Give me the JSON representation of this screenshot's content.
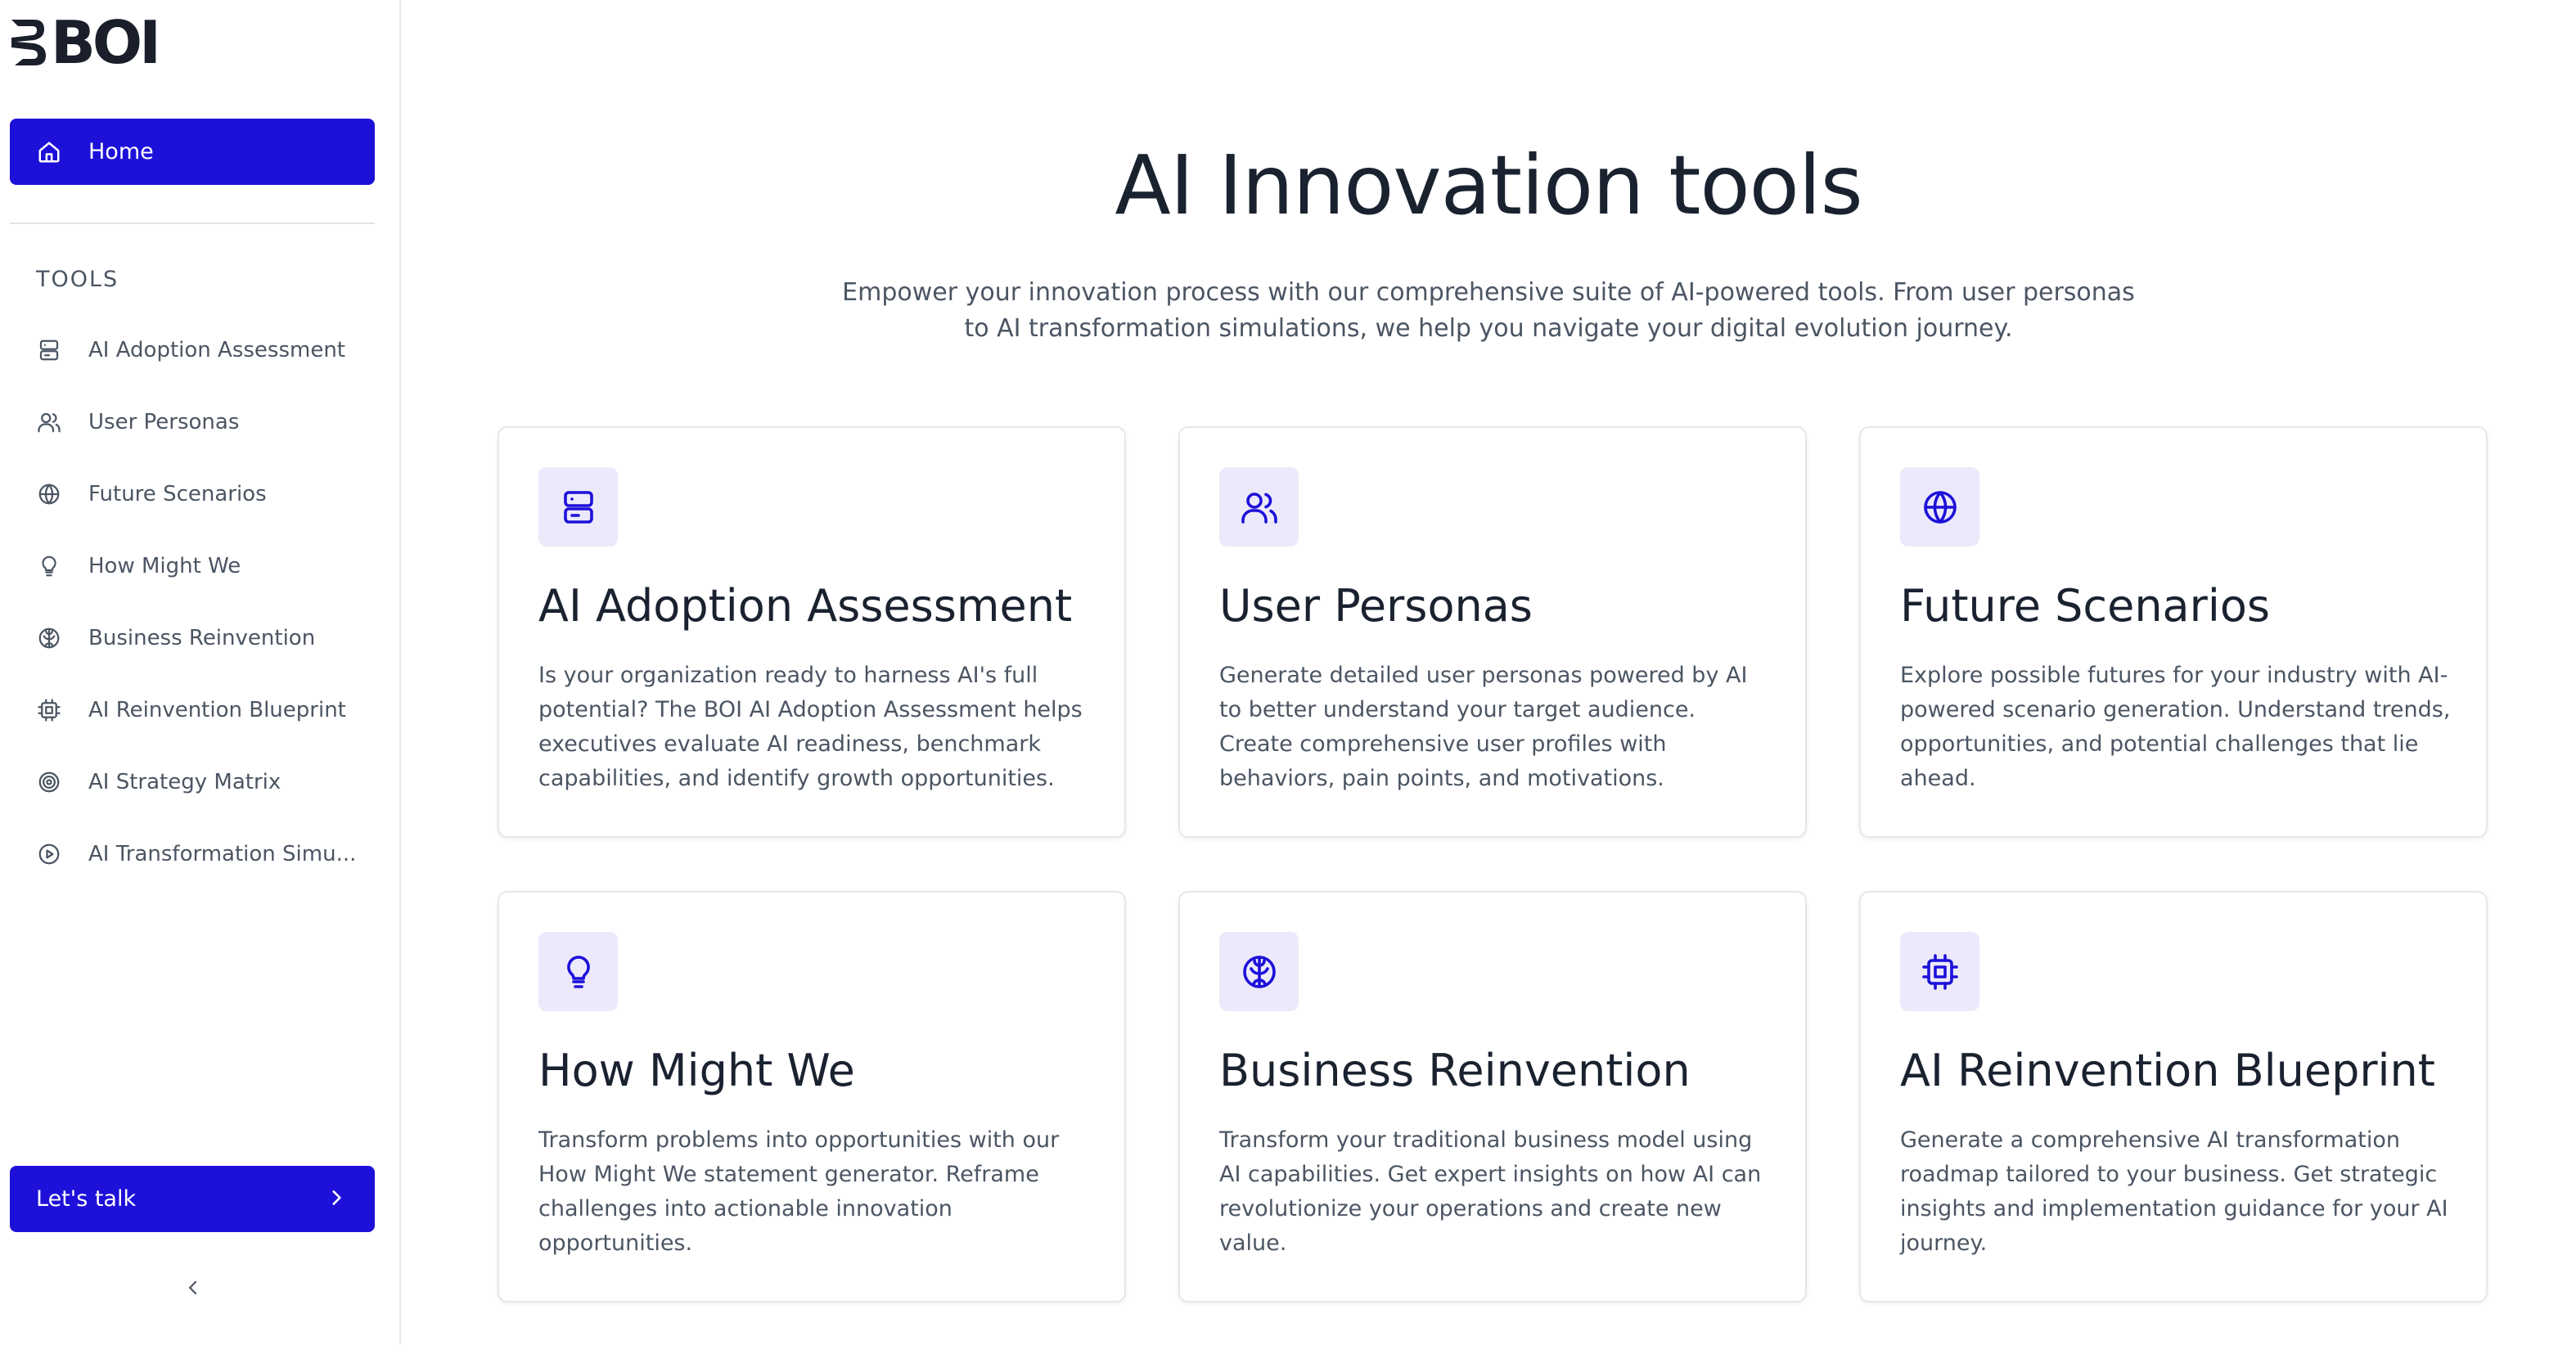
{
  "brand": {
    "logo_text": "BOI",
    "accent_color": "#1d10d9",
    "icon_bg_color": "#ece9fb"
  },
  "sidebar": {
    "home": {
      "label": "Home",
      "icon": "home-icon"
    },
    "tools_heading": "TOOLS",
    "items": [
      {
        "label": "AI Adoption Assessment",
        "icon": "server-icon"
      },
      {
        "label": "User Personas",
        "icon": "users-icon"
      },
      {
        "label": "Future Scenarios",
        "icon": "globe-icon"
      },
      {
        "label": "How Might We",
        "icon": "lightbulb-icon"
      },
      {
        "label": "Business Reinvention",
        "icon": "brain-icon"
      },
      {
        "label": "AI Reinvention Blueprint",
        "icon": "cpu-icon"
      },
      {
        "label": "AI Strategy Matrix",
        "icon": "target-icon"
      },
      {
        "label": "AI Transformation Simu...",
        "icon": "play-circle-icon"
      }
    ],
    "cta_label": "Let's talk",
    "cta_icon": "chevron-right-icon",
    "collapse_icon": "chevron-left-icon"
  },
  "main": {
    "title": "AI Innovation tools",
    "subtitle": "Empower your innovation process with our comprehensive suite of AI-powered tools. From user personas to AI transformation simulations, we help you navigate your digital evolution journey.",
    "cards": [
      {
        "title": "AI Adoption Assessment",
        "description": "Is your organization ready to harness AI's full potential? The BOI AI Adoption Assessment helps executives evaluate AI readiness, benchmark capabilities, and identify growth opportunities.",
        "icon": "server-icon"
      },
      {
        "title": "User Personas",
        "description": "Generate detailed user personas powered by AI to better understand your target audience. Create comprehensive user profiles with behaviors, pain points, and motivations.",
        "icon": "users-icon"
      },
      {
        "title": "Future Scenarios",
        "description": "Explore possible futures for your industry with AI-powered scenario generation. Understand trends, opportunities, and potential challenges that lie ahead.",
        "icon": "globe-icon"
      },
      {
        "title": "How Might We",
        "description": "Transform problems into opportunities with our How Might We statement generator. Reframe challenges into actionable innovation opportunities.",
        "icon": "lightbulb-icon"
      },
      {
        "title": "Business Reinvention",
        "description": "Transform your traditional business model using AI capabilities. Get expert insights on how AI can revolutionize your operations and create new value.",
        "icon": "brain-icon"
      },
      {
        "title": "AI Reinvention Blueprint",
        "description": "Generate a comprehensive AI transformation roadmap tailored to your business. Get strategic insights and implementation guidance for your AI journey.",
        "icon": "cpu-icon"
      }
    ]
  }
}
